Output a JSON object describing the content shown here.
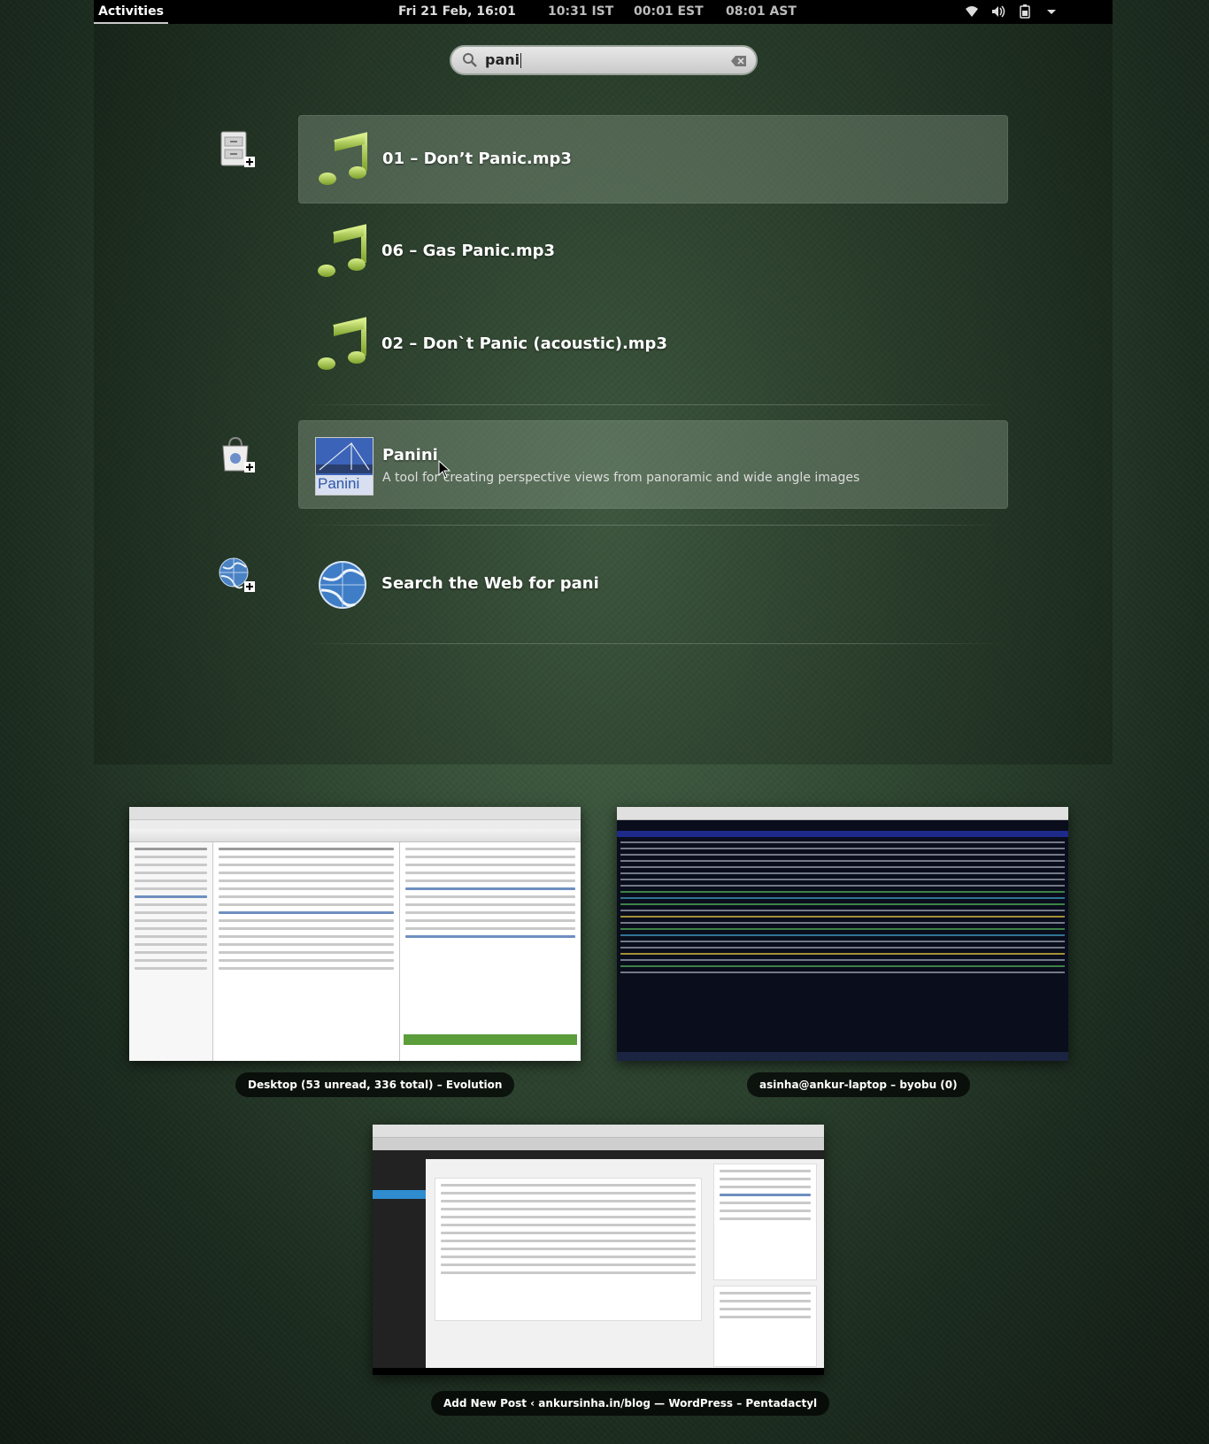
{
  "topbar": {
    "activities": "Activities",
    "datetime": "Fri 21 Feb, 16:01",
    "clocks": [
      "10:31 IST",
      "00:01 EST",
      "08:01 AST"
    ],
    "tray_icons": [
      "wifi-icon",
      "volume-icon",
      "battery-icon",
      "system-menu-arrow-icon"
    ]
  },
  "search": {
    "query": "pani",
    "icon": "search-icon",
    "clear_icon": "clear-icon"
  },
  "providers": [
    {
      "icon": "files-provider-icon",
      "results": [
        {
          "title": "01 – Don’t Panic.mp3",
          "icon": "music-note-icon",
          "selected": true
        },
        {
          "title": "06 – Gas Panic.mp3",
          "icon": "music-note-icon"
        },
        {
          "title": "02 – Don`t Panic (acoustic).mp3",
          "icon": "music-note-icon"
        }
      ]
    },
    {
      "icon": "software-provider-icon",
      "results": [
        {
          "title": "Panini",
          "description": "A tool for creating perspective views from panoramic and wide angle images",
          "icon": "panini-app-icon",
          "icon_text": "Panini"
        }
      ]
    },
    {
      "icon": "web-provider-icon",
      "results": [
        {
          "title": "Search the Web for pani",
          "icon": "globe-icon"
        }
      ]
    }
  ],
  "windows": [
    {
      "title": "Desktop (53 unread, 336 total) – Evolution",
      "app": "evolution"
    },
    {
      "title": "asinha@ankur-laptop – byobu (0)",
      "app": "terminal"
    },
    {
      "title": "Add New Post ‹ ankursinha.in/blog — WordPress – Pentadactyl",
      "app": "browser"
    }
  ],
  "colors": {
    "topbar": "#000000",
    "selected_result": "#7f937f",
    "music_note": "#b7d65b"
  }
}
